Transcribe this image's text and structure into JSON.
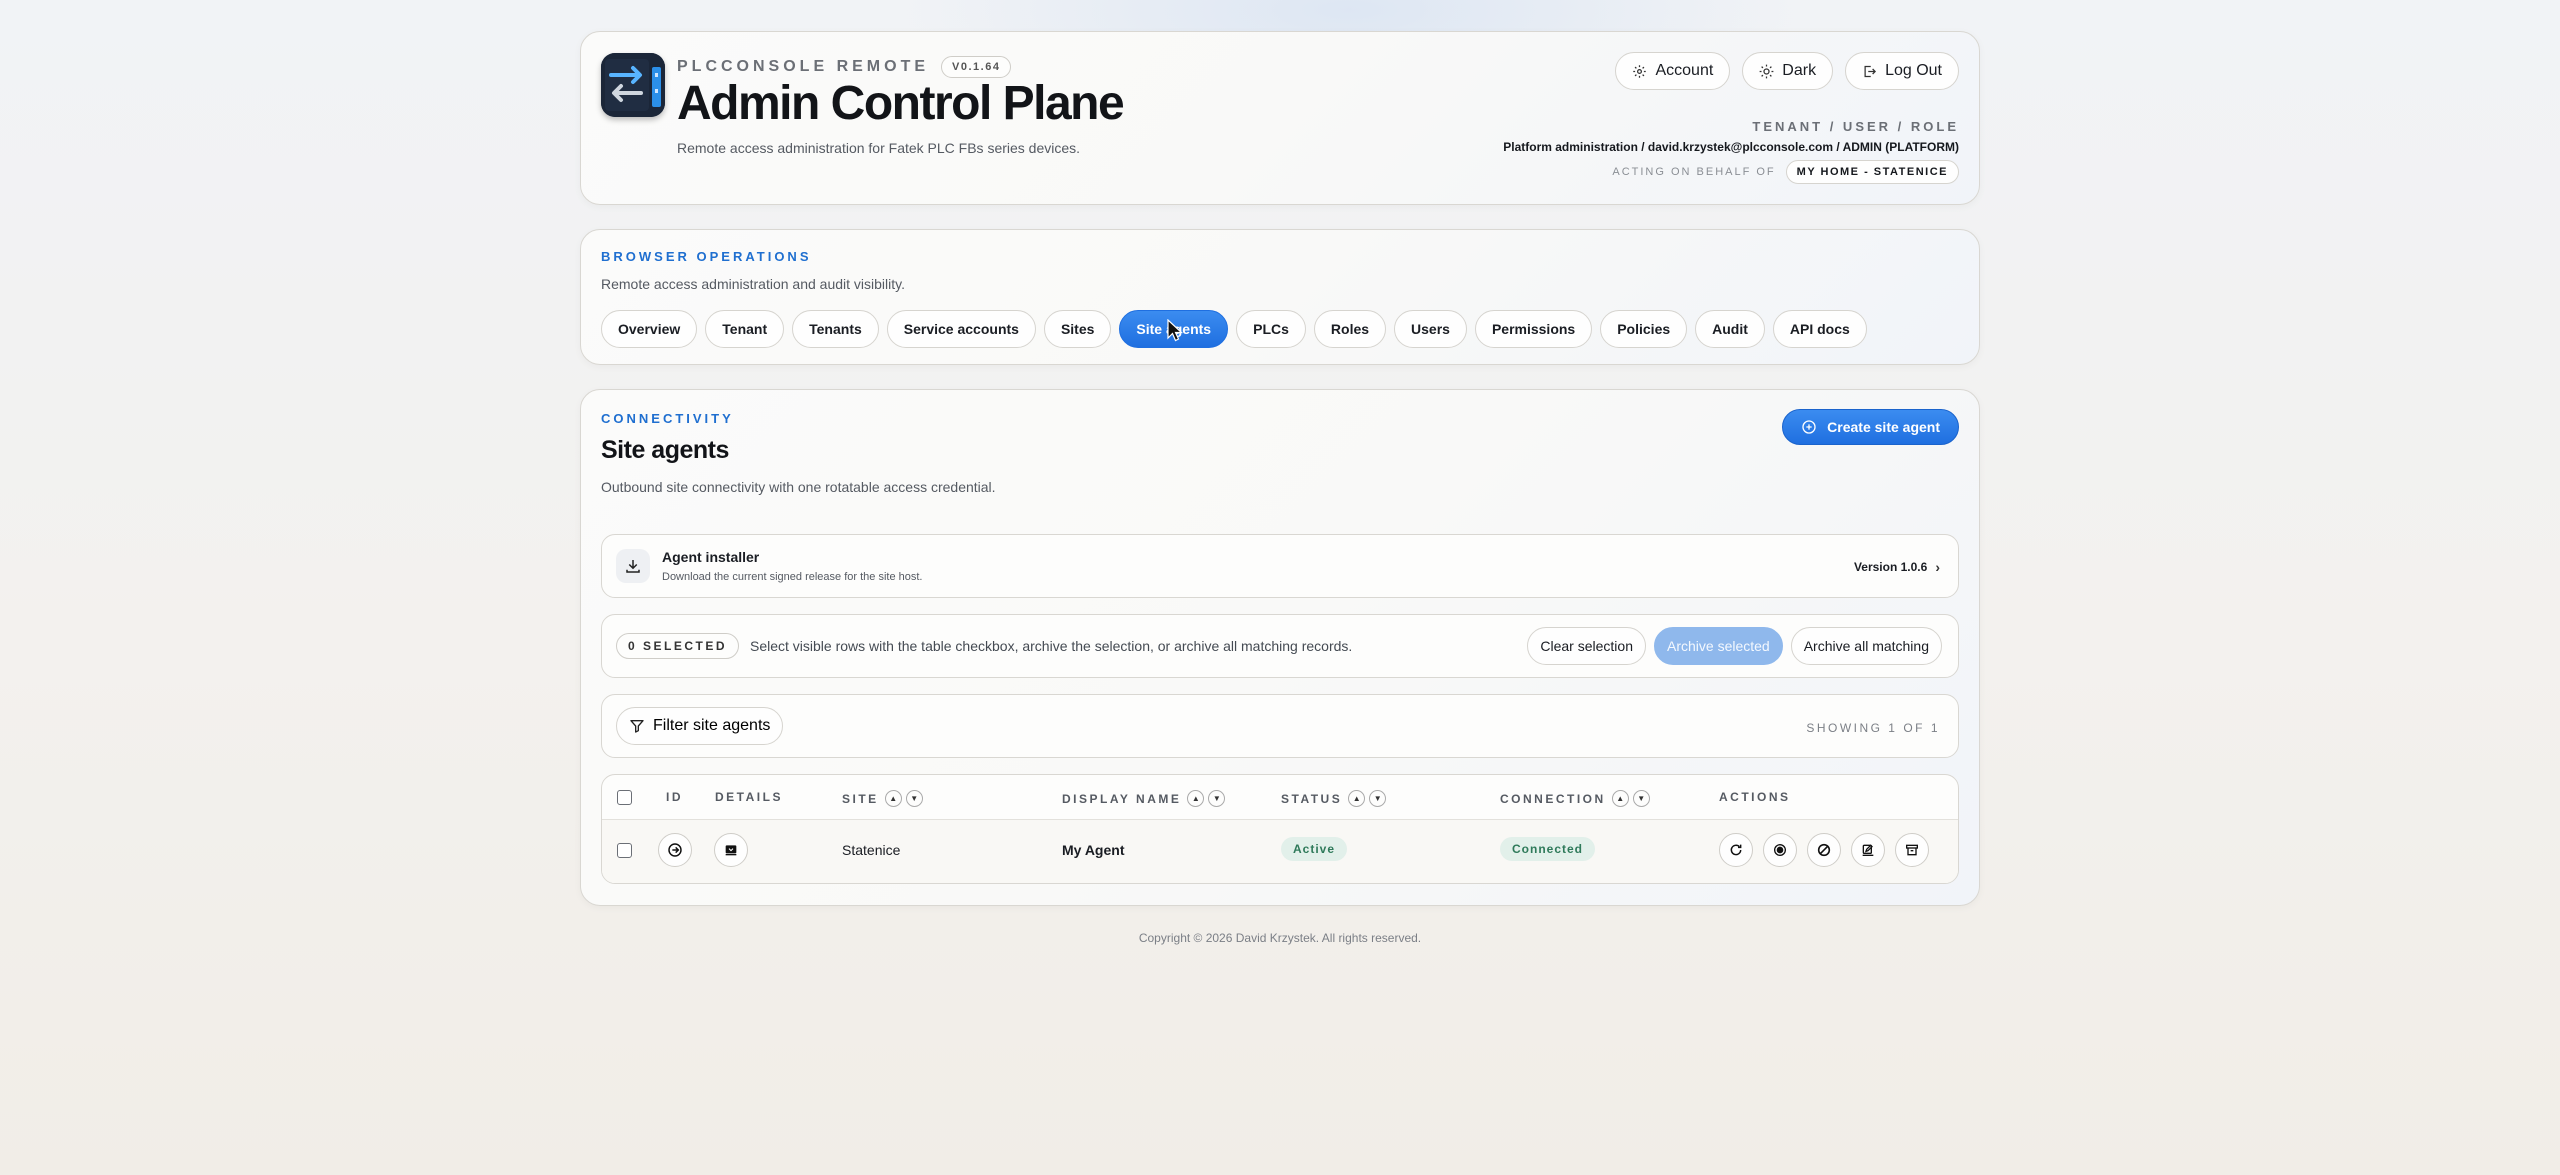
{
  "header": {
    "brand": "PLCCONSOLE REMOTE",
    "version": "V0.1.64",
    "title": "Admin Control Plane",
    "subtitle": "Remote access administration for Fatek PLC FBs series devices.",
    "actions": {
      "account": "Account",
      "theme": "Dark",
      "logout": "Log Out"
    },
    "context_label": "TENANT / USER / ROLE",
    "context_value": "Platform administration / david.krzystek@plcconsole.com / ADMIN (PLATFORM)",
    "behalf_label": "ACTING ON BEHALF OF",
    "behalf_value": "MY HOME - STATENICE"
  },
  "nav": {
    "eyebrow": "BROWSER OPERATIONS",
    "description": "Remote access administration and audit visibility.",
    "tabs": [
      "Overview",
      "Tenant",
      "Tenants",
      "Service accounts",
      "Sites",
      "Site agents",
      "PLCs",
      "Roles",
      "Users",
      "Permissions",
      "Policies",
      "Audit",
      "API docs"
    ],
    "active": "Site agents"
  },
  "main": {
    "eyebrow": "CONNECTIVITY",
    "title": "Site agents",
    "description": "Outbound site connectivity with one rotatable access credential.",
    "create_label": "Create site agent",
    "installer": {
      "title": "Agent installer",
      "subtitle": "Download the current signed release for the site host.",
      "version": "Version 1.0.6",
      "chevron": "›"
    },
    "selection": {
      "badge": "0 SELECTED",
      "text": "Select visible rows with the table checkbox, archive the selection, or archive all matching records.",
      "clear": "Clear selection",
      "archive_selected": "Archive selected",
      "archive_all": "Archive all matching"
    },
    "filter": {
      "label": "Filter site agents",
      "showing": "SHOWING 1 OF 1"
    },
    "table": {
      "columns": {
        "id": "ID",
        "details": "DETAILS",
        "site": "SITE",
        "display_name": "DISPLAY NAME",
        "status": "STATUS",
        "connection": "CONNECTION",
        "actions": "ACTIONS"
      },
      "rows": [
        {
          "site": "Statenice",
          "display_name": "My Agent",
          "status": "Active",
          "connection": "Connected"
        }
      ]
    }
  },
  "footer": "Copyright © 2026 David Krzystek. All rights reserved.",
  "colors": {
    "accent": "#1f6fe0",
    "active_bg": "#e2f0ea",
    "active_text": "#2f7a5a"
  },
  "icons": [
    "gear-icon",
    "sun-icon",
    "logout-icon",
    "plus-circle-icon",
    "download-icon",
    "filter-icon",
    "arrow-right-icon",
    "details-icon",
    "refresh-icon",
    "record-icon",
    "block-icon",
    "edit-icon",
    "archive-icon"
  ]
}
